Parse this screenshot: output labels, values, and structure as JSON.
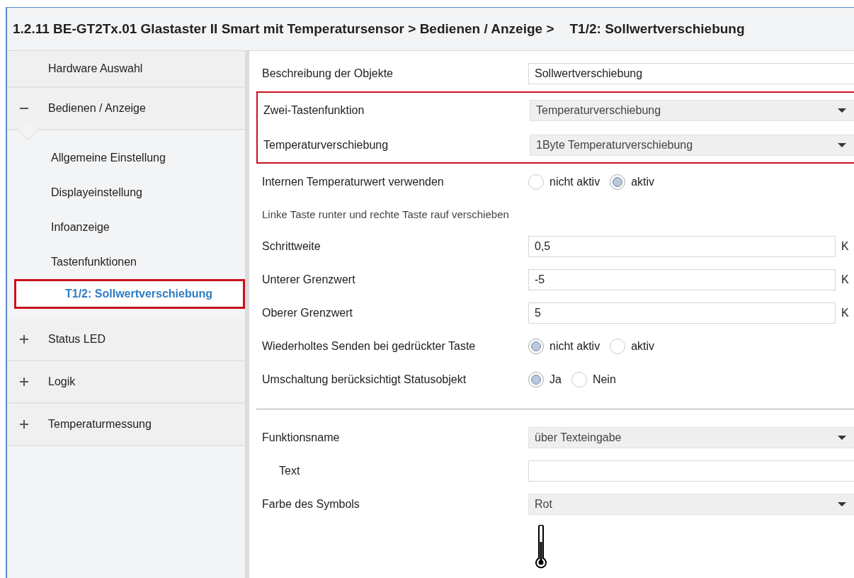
{
  "window": {
    "title": "1.2.11 BE-GT2Tx.01 Glastaster II Smart mit Temperatursensor > Bedienen / Anzeige >",
    "subtitle": "T1/2: Sollwertverschiebung"
  },
  "sidebar": {
    "items": [
      {
        "label": "Hardware Auswahl",
        "selected": false,
        "highlighted": false
      },
      {
        "label": "Bedienen / Anzeige",
        "expanded": true,
        "selected": false,
        "highlighted": false,
        "children": [
          {
            "label": "Allgemeine Einstellung",
            "selected": false,
            "highlighted": false
          },
          {
            "label": "Displayeinstellung",
            "selected": false,
            "highlighted": false
          },
          {
            "label": "Infoanzeige",
            "selected": false,
            "highlighted": false
          },
          {
            "label": "Tastenfunktionen",
            "selected": false,
            "highlighted": false,
            "children": [
              {
                "label": "T1/2: Sollwertverschiebung",
                "selected": true,
                "highlighted": true
              }
            ]
          }
        ]
      },
      {
        "label": "Status LED",
        "expanded": false,
        "selected": false,
        "highlighted": false
      },
      {
        "label": "Logik",
        "expanded": false,
        "selected": false,
        "highlighted": false
      },
      {
        "label": "Temperaturmessung",
        "expanded": false,
        "selected": false,
        "highlighted": false
      }
    ]
  },
  "parameters": [
    {
      "kind": "text",
      "label": "Beschreibung der Objekte",
      "value": "Sollwertverschiebung",
      "highlighted": false
    },
    {
      "kind": "dropdown",
      "label": "Zwei-Tastenfunktion",
      "value": "Temperaturverschiebung",
      "highlighted": true
    },
    {
      "kind": "dropdown",
      "label": "Temperaturverschiebung",
      "value": "1Byte Temperaturverschiebung",
      "highlighted": true
    },
    {
      "kind": "radio",
      "label": "Internen Temperaturwert verwenden",
      "highlighted": false,
      "options": [
        {
          "label": "nicht aktiv",
          "selected": false
        },
        {
          "label": "aktiv",
          "selected": true
        }
      ]
    },
    {
      "kind": "note",
      "label": "Linke Taste runter und rechte Taste rauf verschieben",
      "highlighted": false
    },
    {
      "kind": "number",
      "label": "Schrittweite",
      "value": "0,5",
      "unit": "K",
      "highlighted": false
    },
    {
      "kind": "number",
      "label": "Unterer Grenzwert",
      "value": "-5",
      "unit": "K",
      "highlighted": false
    },
    {
      "kind": "number",
      "label": "Oberer Grenzwert",
      "value": "5",
      "unit": "K",
      "highlighted": false
    },
    {
      "kind": "radio",
      "label": "Wiederholtes Senden bei gedrückter Taste",
      "highlighted": false,
      "options": [
        {
          "label": "nicht aktiv",
          "selected": true
        },
        {
          "label": "aktiv",
          "selected": false
        }
      ]
    },
    {
      "kind": "radio",
      "label": "Umschaltung berücksichtigt Statusobjekt",
      "highlighted": false,
      "options": [
        {
          "label": "Ja",
          "selected": true
        },
        {
          "label": "Nein",
          "selected": false
        }
      ]
    },
    {
      "kind": "divider",
      "highlighted": false
    },
    {
      "kind": "dropdown",
      "label": "Funktionsname",
      "value": "über Texteingabe",
      "highlighted": false
    },
    {
      "kind": "text",
      "label": "Text",
      "indent": true,
      "highlighted": false
    },
    {
      "kind": "dropdown",
      "label": "Farbe des Symbols",
      "value": "Rot",
      "highlighted": false
    },
    {
      "kind": "symbol",
      "highlighted": false
    }
  ]
}
